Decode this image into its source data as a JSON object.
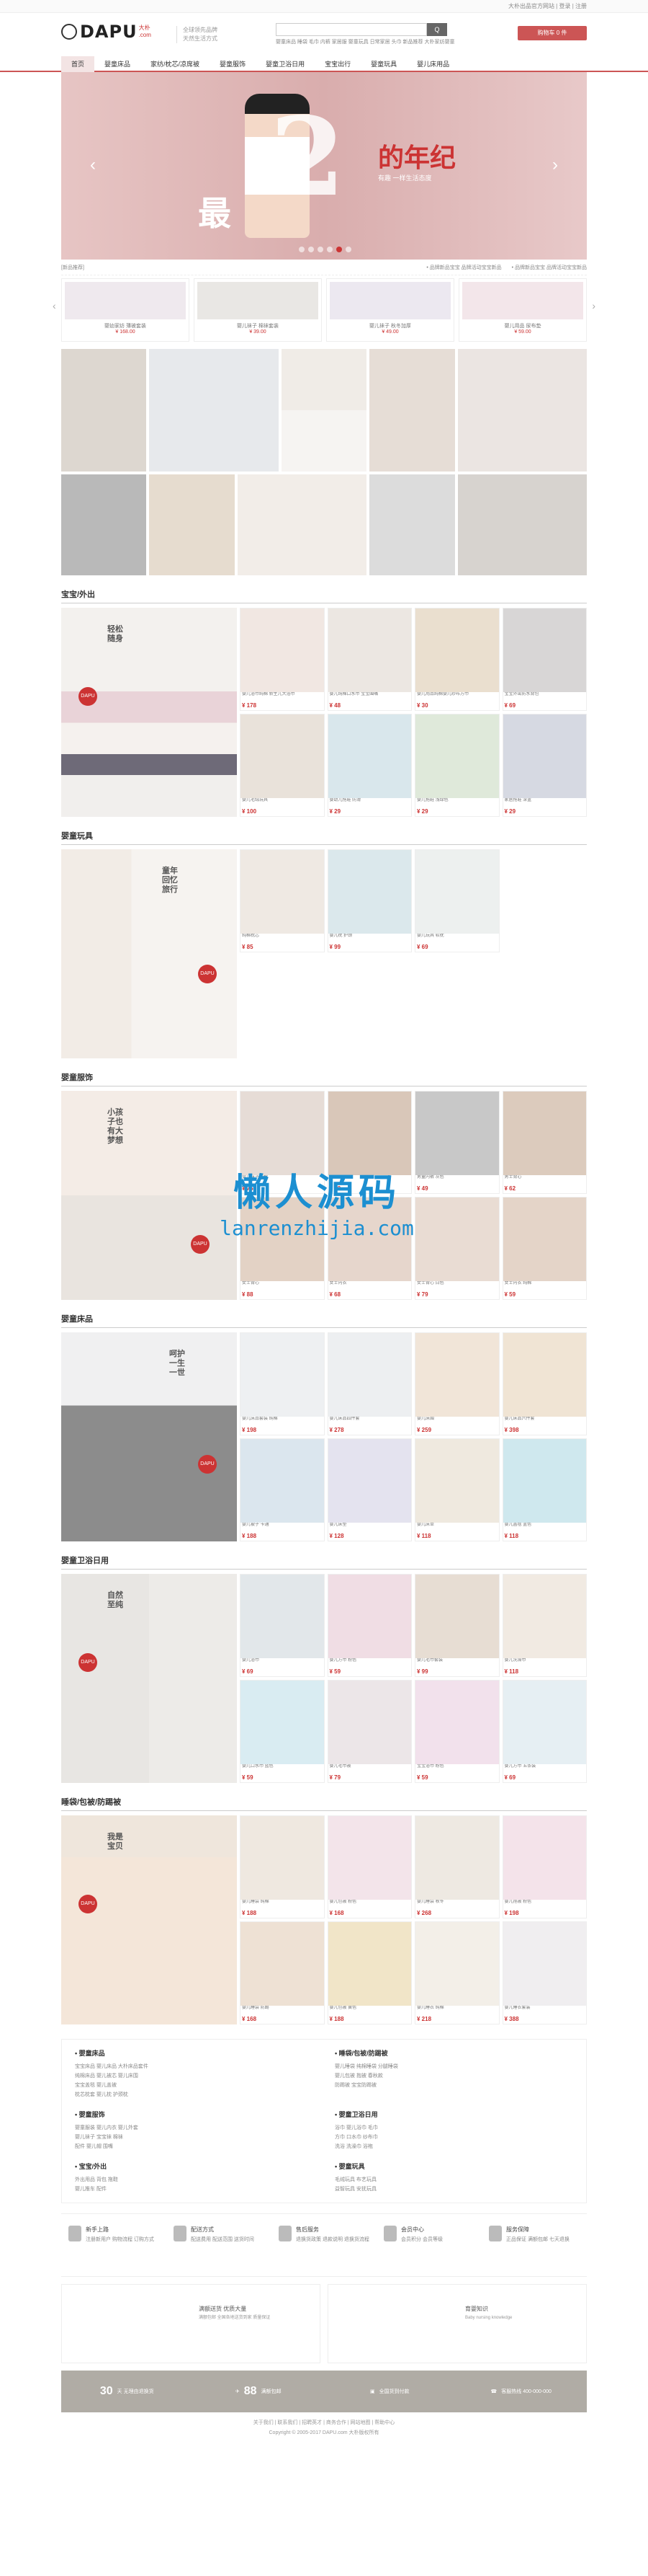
{
  "topbar": {
    "links": "大朴出品官方网站  |  登录  |  注册"
  },
  "header": {
    "brand": "DAPU",
    "brand_cn": "大朴",
    "brand_sub": ".com",
    "slogan_1": "全球领先品牌",
    "slogan_2": "天然生活方式",
    "search_placeholder": "",
    "search_button": "Q",
    "hot_words": "婴童床品  睡袋  毛巾  内裤  家居服  婴童玩具  日常家居  头巾  新品推荐  大朴家纺婴童",
    "cart": "购物车 0 件"
  },
  "nav": [
    "首页",
    "婴童床品",
    "家纺/枕芯/凉席被",
    "婴童服饰",
    "婴童卫浴日用",
    "宝宝出行",
    "婴童玩具",
    "婴儿床用品"
  ],
  "banner": {
    "num": "2",
    "zui": "最",
    "nian": "的年纪",
    "sub": "有趣 一样生活态度",
    "prev": "‹",
    "next": "›"
  },
  "news": {
    "left": "[新品推荐]",
    "item1": "• 品牌新品宝宝 品牌活动宝宝新品",
    "item2": "• 品牌新品宝宝 品牌活动宝宝新品"
  },
  "mini": [
    {
      "name": "婴幼家纺 薄被套装",
      "price": "¥ 168.00"
    },
    {
      "name": "婴儿袜子 棉袜套装",
      "price": "¥ 39.00"
    },
    {
      "name": "婴儿袜子 秋冬加厚",
      "price": "¥ 49.00"
    },
    {
      "name": "婴儿用品 尿布垫",
      "price": "¥ 59.00"
    }
  ],
  "sections": [
    {
      "title": "宝宝/外出",
      "vt": "轻松随身",
      "badge": "DAPU",
      "products": [
        {
          "name": "婴儿浴巾纯棉 新生儿大浴巾",
          "price": "¥ 178"
        },
        {
          "name": "婴儿纯棉口水巾 宝宝围嘴",
          "price": "¥ 48"
        },
        {
          "name": "婴儿用品纯棉婴儿纱布方巾",
          "price": "¥ 30"
        },
        {
          "name": "宝宝外出防水背包",
          "price": "¥ 69"
        },
        {
          "name": "婴儿毛绒玩具",
          "price": "¥ 100"
        },
        {
          "name": "婴幼儿拖鞋 防滑",
          "price": "¥ 29"
        },
        {
          "name": "婴儿拖鞋 浅绿色",
          "price": "¥ 29"
        },
        {
          "name": "家居拖鞋 深蓝",
          "price": "¥ 29"
        }
      ]
    },
    {
      "title": "婴童玩具",
      "vt": "童年回忆旅行",
      "badge": "DAPU",
      "products": [
        {
          "name": "纯棉枕芯",
          "price": "¥ 85"
        },
        {
          "name": "婴儿枕 护颈",
          "price": "¥ 99"
        },
        {
          "name": "婴儿玩具 软枕",
          "price": "¥ 69"
        },
        {
          "name": "",
          "price": ""
        },
        {
          "name": "",
          "price": ""
        },
        {
          "name": "",
          "price": ""
        },
        {
          "name": "",
          "price": ""
        },
        {
          "name": "",
          "price": ""
        }
      ]
    },
    {
      "title": "婴童服饰",
      "vt": "小孩子也有大梦想",
      "badge": "DAPU",
      "products": [
        {
          "name": "婴儿袜子纯棉",
          "price": "¥ 75"
        },
        {
          "name": "婴儿秋衣",
          "price": "¥ 82"
        },
        {
          "name": "男童内裤 灰色",
          "price": "¥ 49"
        },
        {
          "name": "男士背心",
          "price": "¥ 62"
        },
        {
          "name": "女士背心",
          "price": "¥ 88"
        },
        {
          "name": "女士内衣",
          "price": "¥ 68"
        },
        {
          "name": "女士背心 白色",
          "price": "¥ 79"
        },
        {
          "name": "女士内衣 纯棉",
          "price": "¥ 59"
        }
      ]
    },
    {
      "title": "婴童床品",
      "vt": "呵护一生一世",
      "badge": "DAPU",
      "products": [
        {
          "name": "婴儿床品套装 纯棉",
          "price": "¥ 198"
        },
        {
          "name": "婴儿床品四件套",
          "price": "¥ 278"
        },
        {
          "name": "婴儿床围",
          "price": "¥ 259"
        },
        {
          "name": "婴儿床品六件套",
          "price": "¥ 398"
        },
        {
          "name": "婴儿被子 卡通",
          "price": "¥ 188"
        },
        {
          "name": "婴儿床垫",
          "price": "¥ 128"
        },
        {
          "name": "婴儿床单",
          "price": "¥ 118"
        },
        {
          "name": "婴儿盖毯 蓝色",
          "price": "¥ 118"
        }
      ]
    },
    {
      "title": "婴童卫浴日用",
      "vt": "自然至纯",
      "badge": "DAPU",
      "products": [
        {
          "name": "婴儿浴巾",
          "price": "¥ 69"
        },
        {
          "name": "婴儿方巾 粉色",
          "price": "¥ 59"
        },
        {
          "name": "婴儿毛巾套装",
          "price": "¥ 99"
        },
        {
          "name": "婴儿洗澡巾",
          "price": "¥ 118"
        },
        {
          "name": "婴儿口水巾 蓝色",
          "price": "¥ 59"
        },
        {
          "name": "婴儿毛巾被",
          "price": "¥ 79"
        },
        {
          "name": "宝宝浴巾 粉色",
          "price": "¥ 59"
        },
        {
          "name": "婴儿方巾 五条装",
          "price": "¥ 69"
        }
      ]
    },
    {
      "title": "睡袋/包被/防踢被",
      "vt": "我是宝贝",
      "badge": "DAPU",
      "products": [
        {
          "name": "婴儿睡袋 纯棉",
          "price": "¥ 188"
        },
        {
          "name": "婴儿包被 粉色",
          "price": "¥ 168"
        },
        {
          "name": "婴儿睡袋 秋冬",
          "price": "¥ 268"
        },
        {
          "name": "婴儿抱被 粉色",
          "price": "¥ 198"
        },
        {
          "name": "婴儿睡袋 防踢",
          "price": "¥ 168"
        },
        {
          "name": "婴儿包被 黄色",
          "price": "¥ 188"
        },
        {
          "name": "婴儿睡衣 纯棉",
          "price": "¥ 218"
        },
        {
          "name": "婴儿睡衣套装",
          "price": "¥ 388"
        }
      ]
    }
  ],
  "footer": [
    {
      "title": "• 婴童床品",
      "rows": [
        "宝宝床品  婴儿床品 大朴床品套件",
        "纯棉床品  婴儿被芯 婴儿床围",
        "宝宝盖毯  婴儿盖被",
        "枕芯枕套  婴儿枕 护颈枕"
      ]
    },
    {
      "title": "• 睡袋/包被/防踢被",
      "rows": [
        "婴儿睡袋  纯棉睡袋 分腿睡袋",
        "婴儿包被  抱被 春秋款",
        "防踢被  宝宝防踢被"
      ]
    },
    {
      "title": "• 婴童服饰",
      "rows": [
        "婴童服装  婴儿内衣 婴儿外套",
        "婴儿袜子  宝宝袜 棉袜",
        "配件  婴儿帽 围嘴"
      ]
    },
    {
      "title": "• 婴童卫浴日用",
      "rows": [
        "浴巾  婴儿浴巾 毛巾",
        "方巾  口水巾 纱布巾",
        "洗浴  洗澡巾 浴袍"
      ]
    },
    {
      "title": "• 宝宝/外出",
      "rows": [
        "外出用品  背包 拖鞋",
        "婴儿推车  配件"
      ]
    },
    {
      "title": "• 婴童玩具",
      "rows": [
        "毛绒玩具  布艺玩具",
        "益智玩具  安抚玩具"
      ]
    }
  ],
  "services": [
    {
      "title": "新手上路",
      "lines": "注册新用户 购物流程 订购方式"
    },
    {
      "title": "配送方式",
      "lines": "配送费用 配送范围 送货时间"
    },
    {
      "title": "售后服务",
      "lines": "退换货政策 退款说明 退换货流程"
    },
    {
      "title": "会员中心",
      "lines": "会员积分 会员等级"
    },
    {
      "title": "服务保障",
      "lines": "正品保证 满额包邮 七天退换"
    }
  ],
  "about": [
    {
      "title": "满额送货 优质大量",
      "sub": "满额包邮 全国各地送货到家 质量保证"
    },
    {
      "title": "育婴知识",
      "sub": "Baby nursing knowledge"
    }
  ],
  "bottom": [
    {
      "big": "30",
      "txt": "天 无理由退换货"
    },
    {
      "big": "88",
      "txt": "满额包邮"
    },
    {
      "big": "",
      "txt": "全国货到付款"
    },
    {
      "big": "",
      "txt": "客服热线 400-000-000"
    }
  ],
  "copyright": "关于我们 | 联系我们 | 招聘英才 | 商务合作 | 网站地图 | 帮助中心",
  "copyright2": "Copyright © 2005-2017 DAPU.com 大朴版权所有",
  "watermark": {
    "cn": "懒人源码",
    "en": "lanrenzhijia.com"
  }
}
